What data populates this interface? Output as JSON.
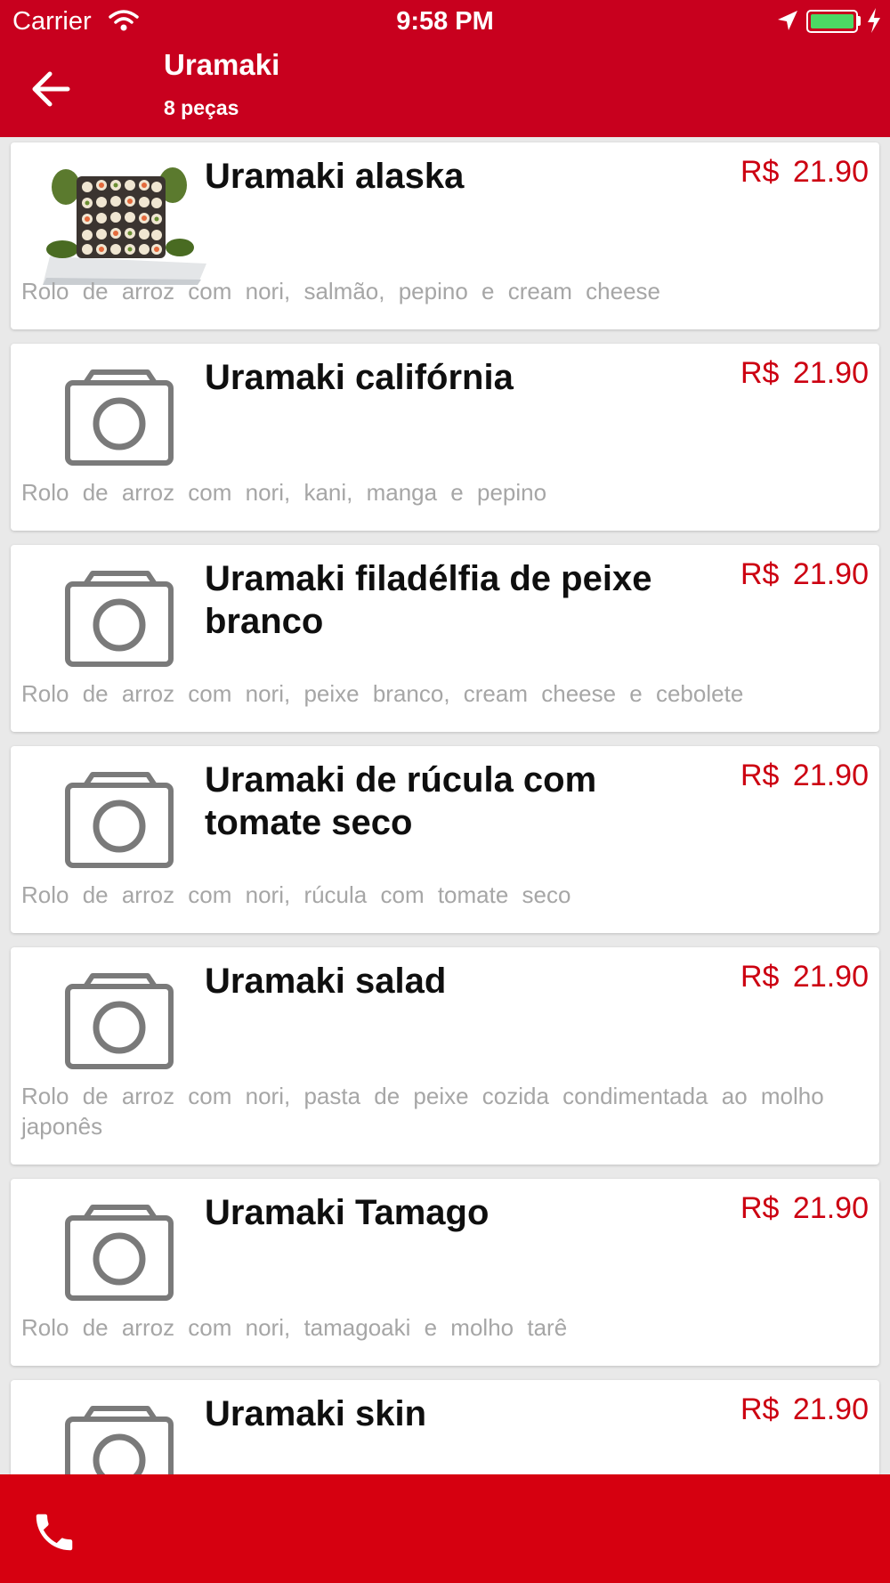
{
  "status_bar": {
    "carrier": "Carrier",
    "time": "9:58 PM",
    "icons": [
      "wifi-icon",
      "location-arrow-icon",
      "battery-icon",
      "charging-bolt-icon"
    ],
    "battery_color": "#4cd964"
  },
  "header": {
    "title": "Uramaki",
    "subtitle": "8 peças",
    "back_icon": "arrow-left-icon",
    "background_color": "#c8001e"
  },
  "items": [
    {
      "name": "Uramaki alaska",
      "price": "R$ 21.90",
      "description": "Rolo de arroz com nori, salmão, pepino e cream cheese",
      "image": "sushi-platter-photo"
    },
    {
      "name": "Uramaki califórnia",
      "price": "R$ 21.90",
      "description": "Rolo de arroz com nori, kani, manga e pepino",
      "image": "camera-placeholder-icon"
    },
    {
      "name": "Uramaki filadélfia de peixe branco",
      "price": "R$ 21.90",
      "description": "Rolo de arroz com nori, peixe branco, cream cheese e cebolete",
      "image": "camera-placeholder-icon"
    },
    {
      "name": "Uramaki de rúcula com tomate seco",
      "price": "R$ 21.90",
      "description": "Rolo de arroz com nori, rúcula com tomate seco",
      "image": "camera-placeholder-icon"
    },
    {
      "name": "Uramaki salad",
      "price": "R$ 21.90",
      "description": "Rolo de arroz com nori, pasta de peixe cozida condimentada ao molho japonês",
      "image": "camera-placeholder-icon"
    },
    {
      "name": "Uramaki Tamago",
      "price": "R$ 21.90",
      "description": "Rolo de arroz com nori, tamagoaki e molho tarê",
      "image": "camera-placeholder-icon"
    },
    {
      "name": "Uramaki skin",
      "price": "R$ 21.90",
      "description": "",
      "image": "camera-placeholder-icon"
    }
  ],
  "price_color": "#cc0011",
  "footer": {
    "phone_icon": "phone-icon",
    "background_color": "#d60010"
  }
}
